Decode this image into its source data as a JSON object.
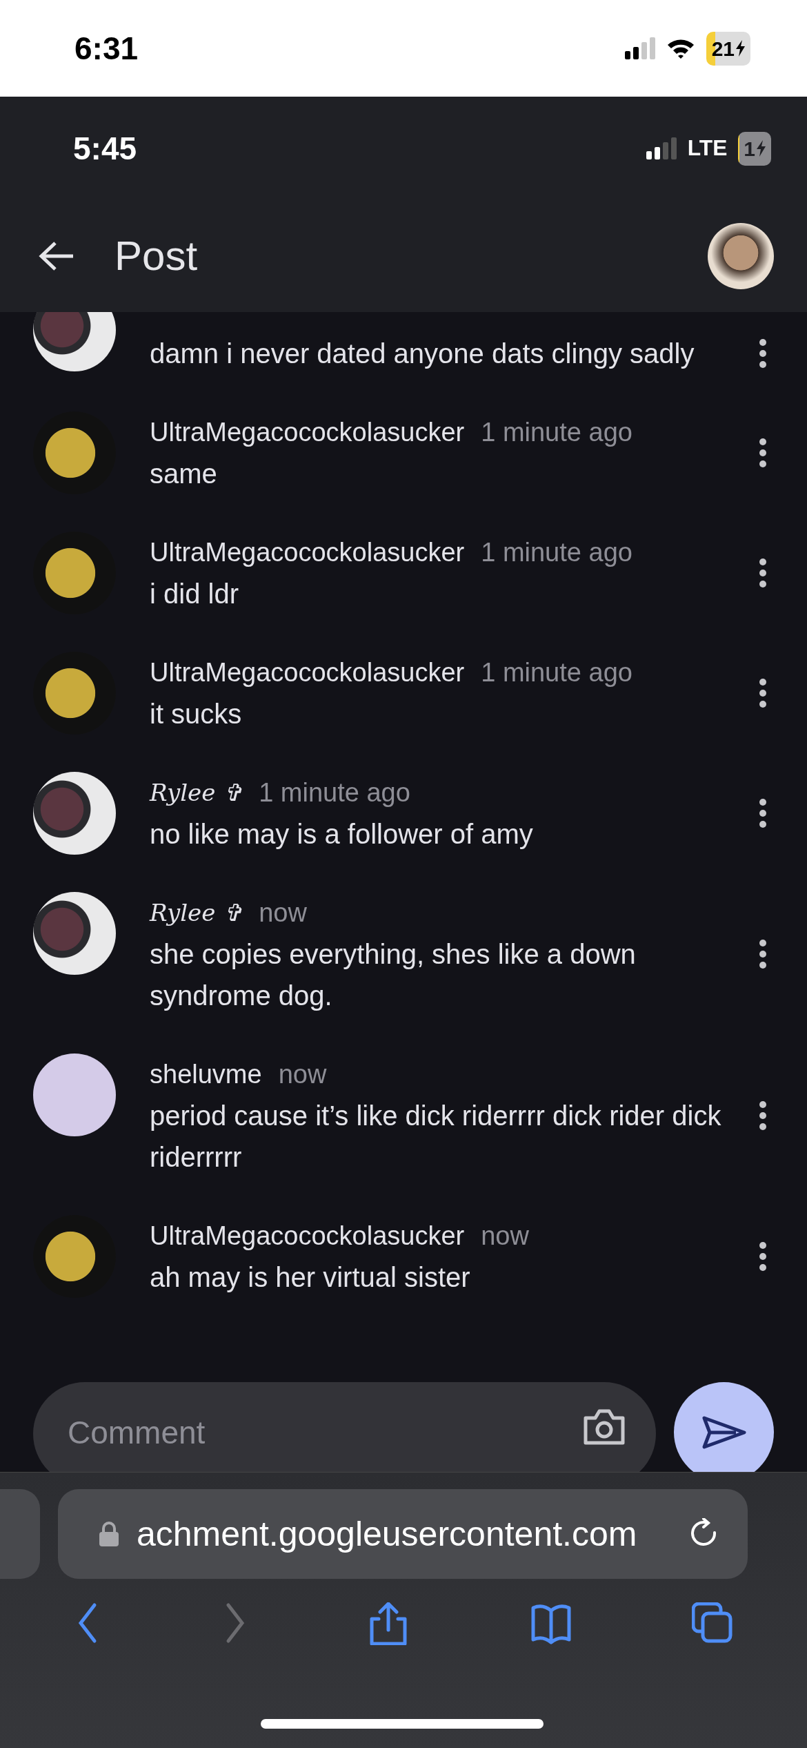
{
  "outer_status_bar": {
    "time": "6:31",
    "battery": "21"
  },
  "inner_status_bar": {
    "time": "5:45",
    "network": "LTE",
    "battery": "1"
  },
  "app_bar": {
    "title": "Post"
  },
  "comments": [
    {
      "avatar": {
        "kind": "photo"
      },
      "body": "damn i never dated anyone dats clingy sadly"
    },
    {
      "avatar": {
        "kind": "meme"
      },
      "author": {
        "kind": "plain",
        "name": "UltraMegacocockolasucker"
      },
      "time": "1 minute ago",
      "body": "same"
    },
    {
      "avatar": {
        "kind": "meme"
      },
      "author": {
        "kind": "plain",
        "name": "UltraMegacocockolasucker"
      },
      "time": "1 minute ago",
      "body": "i did ldr"
    },
    {
      "avatar": {
        "kind": "meme"
      },
      "author": {
        "kind": "plain",
        "name": "UltraMegacocockolasucker"
      },
      "time": "1 minute ago",
      "body": "it sucks"
    },
    {
      "avatar": {
        "kind": "photo"
      },
      "author": {
        "kind": "script",
        "name": "Rylee ✞"
      },
      "time": "1 minute ago",
      "body": "no like may is a follower of amy"
    },
    {
      "avatar": {
        "kind": "photo"
      },
      "author": {
        "kind": "script",
        "name": "Rylee ✞"
      },
      "time": "now",
      "body": "she copies everything, shes like a down syndrome dog."
    },
    {
      "avatar": {
        "kind": "cartoon"
      },
      "author": {
        "kind": "plain",
        "name": "sheluvme"
      },
      "time": "now",
      "body": "period cause it’s like dick riderrrr dick rider dick riderrrrr"
    },
    {
      "avatar": {
        "kind": "meme"
      },
      "author": {
        "kind": "plain",
        "name": "UltraMegacocockolasucker"
      },
      "time": "now",
      "body": "ah may is her virtual sister"
    }
  ],
  "composer": {
    "placeholder": "Comment"
  },
  "browser": {
    "url": "achment.googleusercontent.com",
    "nav_buttons": [
      {
        "kind": "back",
        "disabled": false
      },
      {
        "kind": "forward",
        "disabled": true
      },
      {
        "kind": "share",
        "disabled": false
      },
      {
        "kind": "bookmarks",
        "disabled": false
      },
      {
        "kind": "tabs",
        "disabled": false
      }
    ]
  }
}
